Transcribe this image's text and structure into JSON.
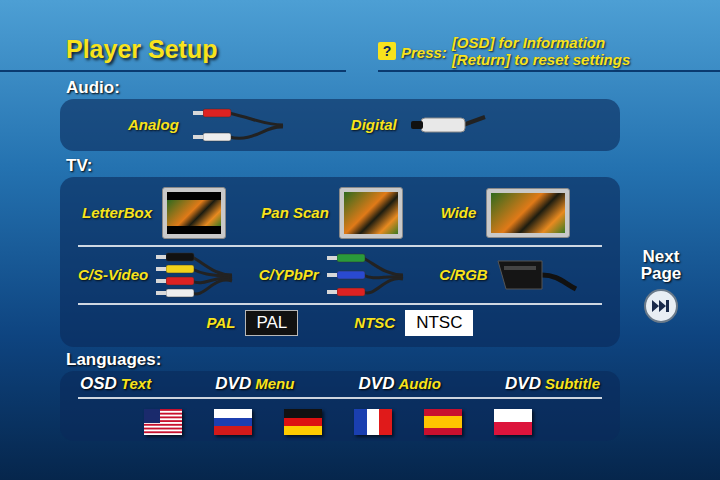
{
  "title": "Player Setup",
  "help": {
    "icon": "?",
    "prefix": "Press:",
    "lines": [
      "[OSD] for Information",
      "[Return] to reset settings"
    ]
  },
  "audio": {
    "label": "Audio:",
    "options": [
      {
        "label": "Analog",
        "kind": "analog"
      },
      {
        "label": "Digital",
        "kind": "digital"
      }
    ]
  },
  "tv": {
    "label": "TV:",
    "aspect": [
      {
        "label": "LetterBox",
        "kind": "letterbox"
      },
      {
        "label": "Pan Scan",
        "kind": "panscan"
      },
      {
        "label": "Wide",
        "kind": "wide"
      }
    ],
    "connections": [
      {
        "label": "C/S-Video",
        "kind": "svideo"
      },
      {
        "label": "C/YPbPr",
        "kind": "ypbpr"
      },
      {
        "label": "C/RGB",
        "kind": "rgb"
      }
    ],
    "systems": [
      {
        "label": "PAL",
        "badge": "PAL",
        "kind": "dark"
      },
      {
        "label": "NTSC",
        "badge": "NTSC",
        "kind": "light"
      }
    ]
  },
  "languages": {
    "label": "Languages:",
    "columns": [
      {
        "prefix": "OSD",
        "label": "Text"
      },
      {
        "prefix": "DVD",
        "label": "Menu"
      },
      {
        "prefix": "DVD",
        "label": "Audio"
      },
      {
        "prefix": "DVD",
        "label": "Subtitle"
      }
    ]
  },
  "next_page": {
    "lines": [
      "Next",
      "Page"
    ]
  }
}
